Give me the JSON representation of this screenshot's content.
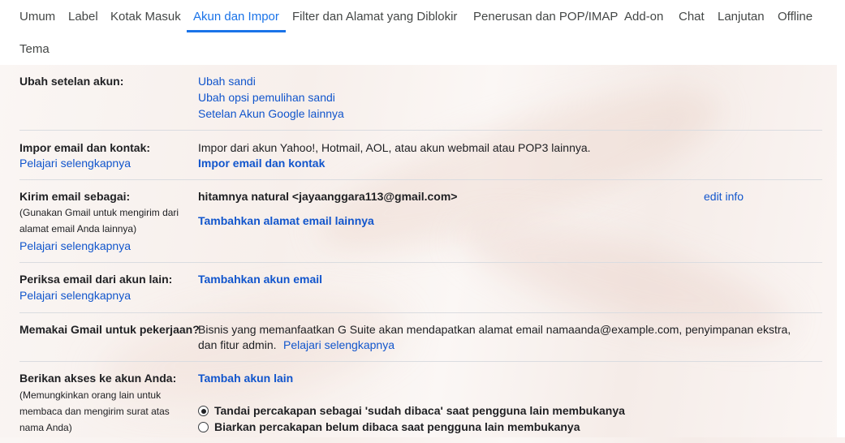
{
  "tabs": [
    {
      "label": "Umum"
    },
    {
      "label": "Label"
    },
    {
      "label": "Kotak Masuk"
    },
    {
      "label": "Akun dan Impor"
    },
    {
      "label": "Filter dan Alamat yang Diblokir"
    },
    {
      "label": "Penerusan dan POP/IMAP"
    },
    {
      "label": "Add-on"
    },
    {
      "label": "Chat"
    },
    {
      "label": "Lanjutan"
    },
    {
      "label": "Offline"
    },
    {
      "label": "Tema"
    }
  ],
  "active_tab": "Akun dan Impor",
  "sections": {
    "change_account": {
      "label": "Ubah setelan akun:",
      "links": [
        "Ubah sandi",
        "Ubah opsi pemulihan sandi",
        "Setelan Akun Google lainnya"
      ]
    },
    "import": {
      "label": "Impor email dan kontak:",
      "learn_more": "Pelajari selengkapnya",
      "description": "Impor dari akun Yahoo!, Hotmail, AOL, atau akun webmail atau POP3 lainnya.",
      "action": "Impor email dan kontak"
    },
    "send_as": {
      "label": "Kirim email sebagai:",
      "note_lines": [
        "(Gunakan Gmail untuk mengirim dari",
        "alamat email Anda lainnya)"
      ],
      "learn_more": "Pelajari selengkapnya",
      "identity": "hitamnya natural <jayaanggara113@gmail.com>",
      "edit": "edit info",
      "add": "Tambahkan alamat email lainnya"
    },
    "check_mail": {
      "label": "Periksa email dari akun lain:",
      "learn_more": "Pelajari selengkapnya",
      "action": "Tambahkan akun email"
    },
    "work": {
      "label": "Memakai Gmail untuk pekerjaan?",
      "line1": "Bisnis yang memanfaatkan G Suite akan mendapatkan alamat email namaanda@example.com, penyimpanan ekstra,",
      "line2": "dan fitur admin.",
      "learn_more": "Pelajari selengkapnya"
    },
    "grant_access": {
      "label": "Berikan akses ke akun Anda:",
      "note_lines": [
        "(Memungkinkan orang lain untuk",
        "membaca dan mengirim surat atas",
        "nama Anda)"
      ],
      "action": "Tambah akun lain",
      "options": [
        {
          "label": "Tandai percakapan sebagai 'sudah dibaca' saat pengguna lain membukanya",
          "selected": true
        },
        {
          "label": "Biarkan percakapan belum dibaca saat pengguna lain membukanya",
          "selected": false
        }
      ]
    }
  }
}
